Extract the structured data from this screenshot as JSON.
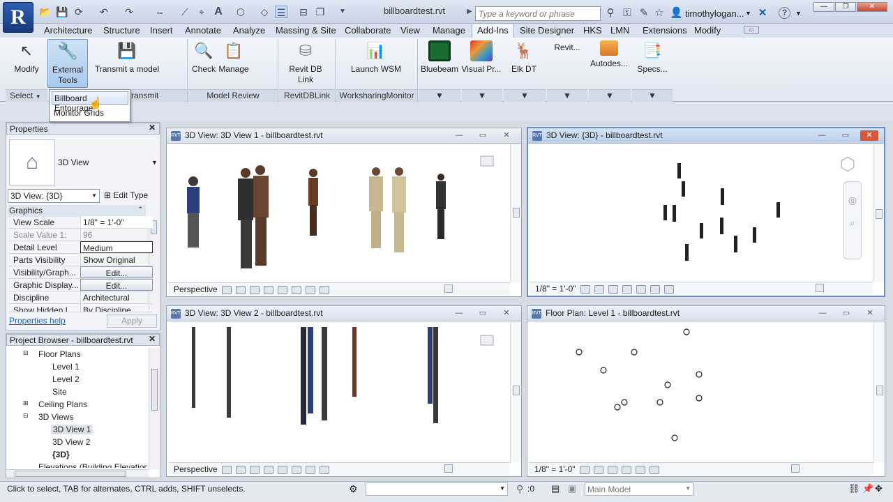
{
  "app": {
    "logo": "R",
    "doc_title": "billboardtest.rvt",
    "search_placeholder": "Type a keyword or phrase",
    "user": "timothylogan..."
  },
  "tabs": [
    "Architecture",
    "Structure",
    "Insert",
    "Annotate",
    "Analyze",
    "Massing & Site",
    "Collaborate",
    "View",
    "Manage",
    "Add-Ins",
    "Site Designer",
    "HKS",
    "LMN",
    "Extensions",
    "Modify"
  ],
  "active_tab": "Add-Ins",
  "ribbon": {
    "modify": "Modify",
    "external_tools": "External\nTools",
    "external_tools_l1": "External",
    "external_tools_l2": "Tools",
    "transmit": "Transmit a model",
    "check": "Check",
    "manage": "Manage",
    "revit_db_link": "Revit DB Link",
    "launch_wsm": "Launch WSM",
    "bluebeam": "Bluebeam",
    "visual_pr": "Visual Pr...",
    "elk_dt": "Elk DT",
    "revit_more": "Revit...",
    "autodes": "Autodes...",
    "specs": "Specs...",
    "panels": {
      "select": "Select",
      "transmit": "ransmit",
      "model_review": "Model Review",
      "revitdblink": "RevitDBLink",
      "worksharing": "WorksharingMonitor"
    }
  },
  "dropdown": {
    "items": [
      "Billboard Entourage",
      "Monitor Grids"
    ]
  },
  "properties": {
    "title": "Properties",
    "type_name": "3D View",
    "selector": "3D View: {3D}",
    "edit_type": "Edit Type",
    "section": "Graphics",
    "rows": [
      {
        "k": "View Scale",
        "v": "1/8\" = 1'-0\""
      },
      {
        "k": "Scale Value    1:",
        "v": "96"
      },
      {
        "k": "Detail Level",
        "v": "Medium"
      },
      {
        "k": "Parts Visibility",
        "v": "Show Original"
      },
      {
        "k": "Visibility/Graph...",
        "v": "Edit..."
      },
      {
        "k": "Graphic Display...",
        "v": "Edit..."
      },
      {
        "k": "Discipline",
        "v": "Architectural"
      },
      {
        "k": "Show Hidden L...",
        "v": "By Discipline"
      }
    ],
    "help": "Properties help",
    "apply": "Apply"
  },
  "browser": {
    "title": "Project Browser - billboardtest.rvt",
    "nodes": [
      "Floor Plans",
      "Level 1",
      "Level 2",
      "Site",
      "Ceiling Plans",
      "3D Views",
      "3D View 1",
      "3D View 2",
      "{3D}",
      "Elevations (Building Elevation"
    ]
  },
  "views": [
    {
      "title": "3D View: 3D View 1 - billboardtest.rvt",
      "status": "Perspective"
    },
    {
      "title": "3D View: {3D} - billboardtest.rvt",
      "status": "1/8\" = 1'-0\""
    },
    {
      "title": "3D View: 3D View 2 - billboardtest.rvt",
      "status": "Perspective"
    },
    {
      "title": "Floor Plan: Level 1 - billboardtest.rvt",
      "status": "1/8\" = 1'-0\""
    }
  ],
  "statusbar": {
    "text": "Click to select, TAB for alternates, CTRL adds, SHIFT unselects.",
    "count": ":0",
    "model": "Main Model"
  },
  "colors": {
    "accent": "#6b8fbf",
    "logo_blue": "#2e5fb4"
  }
}
